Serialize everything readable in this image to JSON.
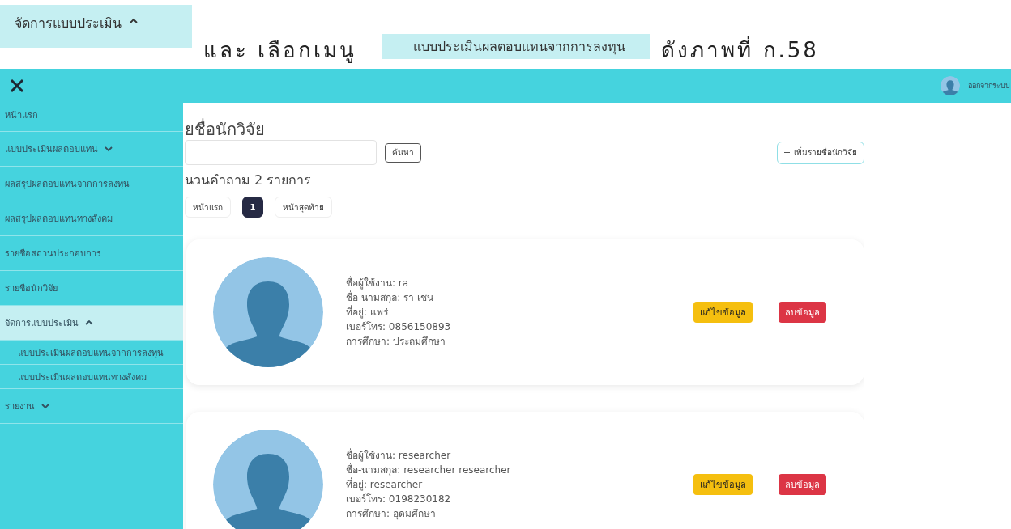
{
  "caption": {
    "menu_chip": {
      "label": "จัดการแบบประเมิน",
      "expanded": true
    },
    "text_1": "และ เลือกเมนู",
    "submenu_chip": "แบบประเมินผลตอบแทนจากการลงทุน",
    "text_2": "ดังภาพที่ ก.58"
  },
  "topbar": {
    "logout": "ออกจากระบบ"
  },
  "sidebar": {
    "items": [
      {
        "label": "หน้าแรก",
        "kind": "link",
        "selected": false
      },
      {
        "label": "แบบประเมินผลตอบแทน",
        "kind": "group",
        "expanded": false,
        "selected": false
      },
      {
        "label": "ผลสรุปผลตอบแทนจากการลงทุน",
        "kind": "link",
        "selected": false
      },
      {
        "label": "ผลสรุปผลตอบแทนทางสังคม",
        "kind": "link",
        "selected": false
      },
      {
        "label": "รายชื่อสถานประกอบการ",
        "kind": "link",
        "selected": false
      },
      {
        "label": "รายชื่อนักวิจัย",
        "kind": "link",
        "selected": false
      },
      {
        "label": "จัดการแบบประเมิน",
        "kind": "group",
        "expanded": true,
        "selected": true,
        "children": [
          {
            "label": "แบบประเมินผลตอบแทนจากการลงทุน",
            "selected": false
          },
          {
            "label": "แบบประเมินผลตอบแทนทางสังคม",
            "selected": false
          }
        ]
      },
      {
        "label": "รายงาน",
        "kind": "group",
        "expanded": false,
        "selected": false
      }
    ]
  },
  "main": {
    "title": "ยชื่อนักวิจัย",
    "search_button": "ค้นหา",
    "add_button": "เพิ่มรายชื่อนักวิจัย",
    "count": "นวนคำถาม 2 รายการ",
    "pagination": [
      {
        "label": "หน้าแรก",
        "selected": false
      },
      {
        "label": "1",
        "selected": true
      },
      {
        "label": "หน้าสุดท้าย",
        "selected": false
      }
    ],
    "researchers": [
      {
        "lines": [
          "ชื่อผู้ใช้งาน: ra",
          "ชื่อ-นามสกุล: รา เชน",
          "ที่อยู่: แพร่",
          "เบอร์โทร: 0856150893",
          "การศึกษา: ประถมศึกษา"
        ],
        "edit": "แก้ไขข้อมูล",
        "delete": "ลบข้อมูล"
      },
      {
        "lines": [
          "ชื่อผู้ใช้งาน: researcher",
          "ชื่อ-นามสกุล: researcher researcher",
          "ที่อยู่: researcher",
          "เบอร์โทร: 0198230182",
          "การศึกษา: อุดมศึกษา"
        ],
        "edit": "แก้ไขข้อมูล",
        "delete": "ลบข้อมูล"
      }
    ]
  }
}
